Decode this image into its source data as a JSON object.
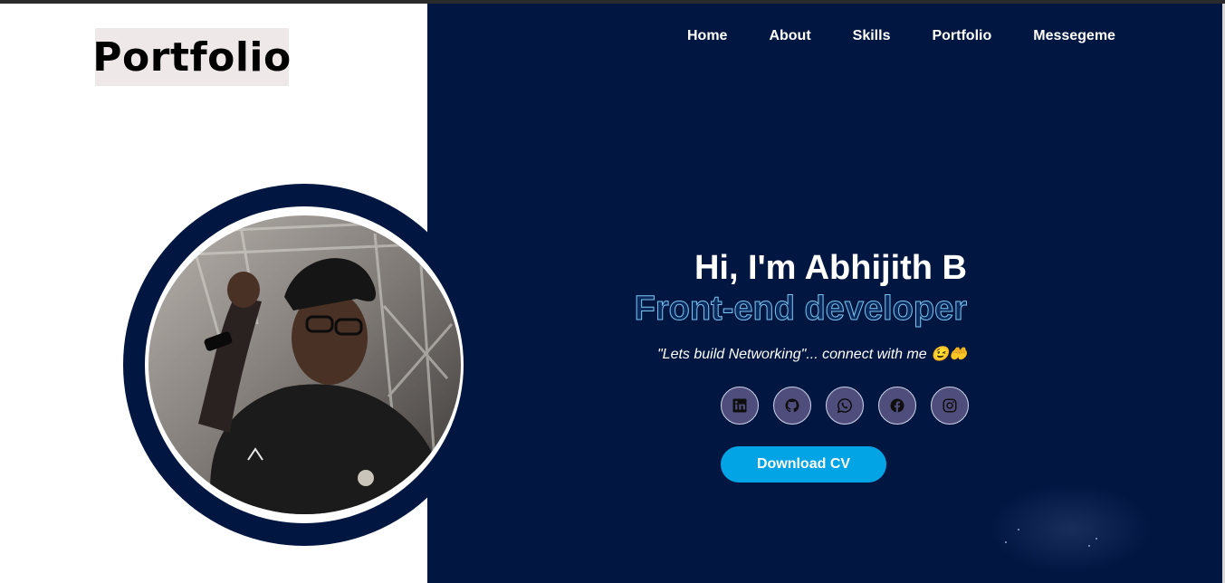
{
  "brand": {
    "title": "Portfolio"
  },
  "nav": {
    "items": [
      "Home",
      "About",
      "Skills",
      "Portfolio",
      "Messegeme"
    ]
  },
  "hero": {
    "greeting": "Hi, I'm Abhijith B",
    "role": "Front-end developer",
    "tagline": "\"Lets build Networking\"... connect with me 😉🤲"
  },
  "socials": [
    {
      "icon": "linkedin-icon"
    },
    {
      "icon": "github-icon"
    },
    {
      "icon": "whatsapp-icon"
    },
    {
      "icon": "facebook-icon"
    },
    {
      "icon": "instagram-icon"
    }
  ],
  "cta": {
    "download_label": "Download CV"
  },
  "colors": {
    "navy": "#011641",
    "accent": "#02a4e6",
    "social_bg": "#4e4d7c",
    "role_stroke": "#7dc6f0"
  }
}
